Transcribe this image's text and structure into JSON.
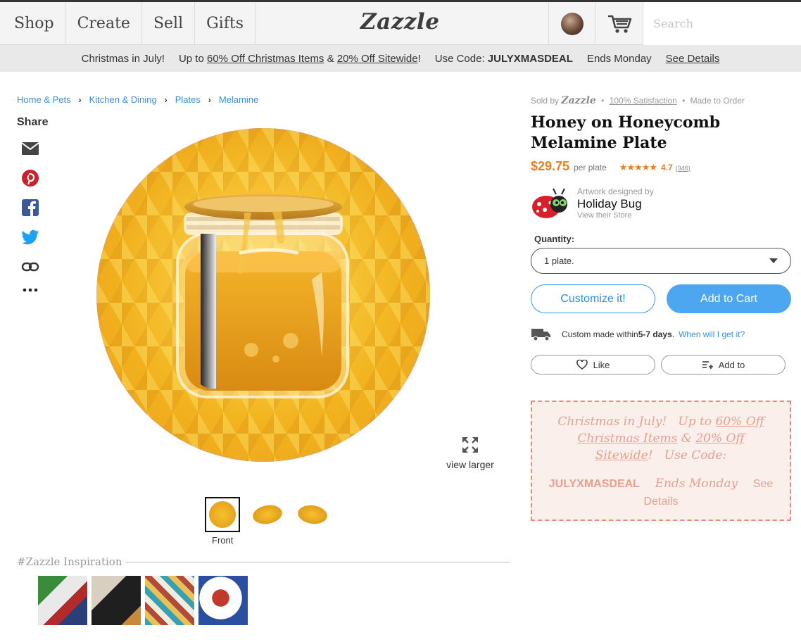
{
  "nav": {
    "items": [
      "Shop",
      "Create",
      "Sell",
      "Gifts"
    ],
    "logo": "Zazzle",
    "search_placeholder": "Search"
  },
  "promo_bar": {
    "headline": "Christmas in July!",
    "offer_prefix": "Up to ",
    "offer_link1": "60% Off Christmas Items",
    "offer_amp": " & ",
    "offer_link2": "20% Off Sitewide",
    "offer_suffix": "!",
    "code_label": "Use Code: ",
    "code": "JULYXMASDEAL",
    "ends": "Ends Monday",
    "details": "See Details"
  },
  "breadcrumbs": [
    "Home & Pets",
    "Kitchen & Dining",
    "Plates",
    "Melamine"
  ],
  "share": {
    "label": "Share",
    "icons": [
      "email-icon",
      "pinterest-icon",
      "facebook-icon",
      "twitter-icon",
      "link-icon",
      "more-icon"
    ]
  },
  "product": {
    "sold_by": "Sold by",
    "sold_by_brand": "Zazzle",
    "satisfaction": "100% Satisfaction",
    "made_to_order": "Made to Order",
    "title": "Honey on Honeycomb Melamine Plate",
    "price": "$29.75",
    "price_unit": "per plate",
    "stars": "★★★★★",
    "rating": "4.7",
    "review_count": "(346)",
    "accent_color": "#e5821d"
  },
  "designer": {
    "label": "Artwork designed by",
    "name": "Holiday Bug",
    "store_link": "View their Store"
  },
  "quantity": {
    "label": "Quantity:",
    "value": "1 plate."
  },
  "buttons": {
    "customize": "Customize it!",
    "add_to_cart": "Add to Cart",
    "like": "Like",
    "add_to": "Add to",
    "primary_color": "#4da6f0"
  },
  "shipping": {
    "prefix": "Custom made within ",
    "days": "5-7 days",
    "suffix": ".",
    "link": "When will I get it?"
  },
  "gallery": {
    "view_larger": "view larger",
    "front_label": "Front",
    "thumb_count": 3
  },
  "inspiration": {
    "title": "#Zazzle Inspiration",
    "count": 4
  },
  "promo_box": {
    "line1": "Christmas in July!",
    "up_to": "Up to ",
    "link1": "60% Off Christmas Items",
    "amp": " & ",
    "link2": "20% Off Sitewide",
    "excl": "!",
    "use_code": "Use Code:",
    "code": "JULYXMASDEAL",
    "ends": "Ends Monday",
    "see": "See",
    "details": "Details",
    "color": "#e8a08f"
  }
}
